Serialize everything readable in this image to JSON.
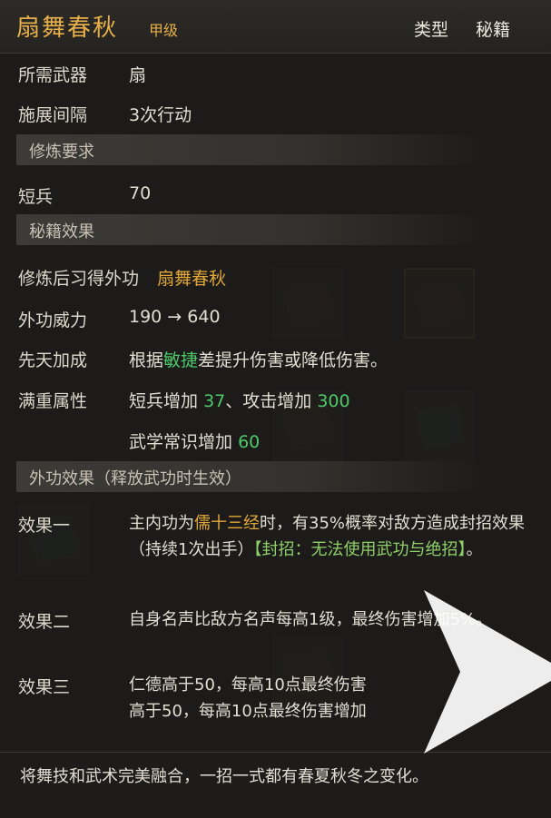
{
  "item": {
    "name": "扇舞春秋",
    "grade": "甲级",
    "type_label": "类型",
    "type_value": "秘籍"
  },
  "requirements": {
    "weapon_label": "所需武器",
    "weapon_value": "扇",
    "interval_label": "施展间隔",
    "interval_value": "3次行动"
  },
  "training": {
    "section_title": "修炼要求",
    "skill_label": "短兵",
    "skill_value": "70"
  },
  "book_effect": {
    "section_title": "秘籍效果",
    "learn_prefix": "修炼后习得外功",
    "learn_skill": "扇舞春秋",
    "power_label": "外功威力",
    "power_value": "190 → 640",
    "innate_label": "先天加成",
    "innate_pre": "根据",
    "innate_attr": "敏捷",
    "innate_post": "差提升伤害或降低伤害。",
    "full_label": "满重属性",
    "full_line1_a": "短兵增加",
    "full_line1_a_val": "37",
    "full_line1_sep": "、攻击增加",
    "full_line1_b_val": "300",
    "full_line2_a": "武学常识增加",
    "full_line2_a_val": "60"
  },
  "martial_effect": {
    "section_title": "外功效果（释放武功时生效）",
    "effect1_label": "效果一",
    "effect1_pre": "主内功为",
    "effect1_hl": "儒十三经",
    "effect1_mid": "时，有35%概率对敌方造成封招效果（持续1次出手）",
    "effect1_tag": "【封招：无法使用武功与绝招】",
    "effect1_end": "。",
    "effect2_label": "效果二",
    "effect2_text": "自身名声比敌方名声每高1级，最终伤害增加5%。",
    "effect3_label": "效果三",
    "effect3_line1": "仁德高于50，每高10点最终伤害",
    "effect3_line2": "高于50，每高10点最终伤害增加"
  },
  "description": "将舞技和武术完美融合，一招一式都有春夏秋冬之变化。",
  "colors": {
    "accent_gold": "#e0a83a",
    "value_green": "#4ec86a",
    "tag_green": "#8fcf6a"
  }
}
